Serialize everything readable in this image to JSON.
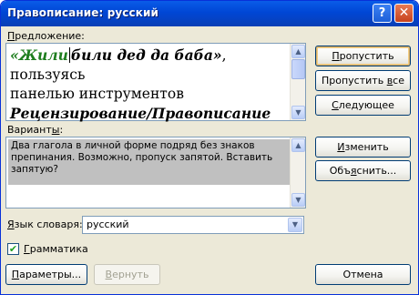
{
  "window": {
    "title": "Правописание: русский",
    "help_label": "?",
    "close_label": "✕"
  },
  "sentence": {
    "label_pre": "",
    "label_u": "П",
    "label_post": "редложение:",
    "flagged_text": "«Жили",
    "text_part2": "били дед да баба»",
    "text_part3": ", пользуясь",
    "line2": "панелью инструментов",
    "line3": "Рецензирование/Правописание"
  },
  "variants": {
    "label_pre": "Вариант",
    "label_u": "ы",
    "label_post": ":",
    "selected_text": "Два глагола в личной форме подряд без знаков препинания. Возможно, пропуск запятой. Вставить запятую?"
  },
  "dictionary": {
    "label_pre": "",
    "label_u": "Я",
    "label_post": "зык словаря:",
    "value": "русский"
  },
  "grammar": {
    "checked": true,
    "check_mark": "✔",
    "label_pre": "",
    "label_u": "Г",
    "label_post": "рамматика"
  },
  "buttons": {
    "skip": {
      "pre": "",
      "u": "П",
      "post": "ропустить"
    },
    "skip_all": {
      "pre": "Пропустить ",
      "u": "в",
      "post": "се"
    },
    "next": {
      "pre": "",
      "u": "С",
      "post": "ледующее"
    },
    "change": {
      "pre": "",
      "u": "И",
      "post": "зменить"
    },
    "explain": {
      "pre": "Объ",
      "u": "я",
      "post": "снить..."
    },
    "options": {
      "pre": "",
      "u": "П",
      "post": "араметры..."
    },
    "undo": {
      "pre": "",
      "u": "В",
      "post": "ернуть"
    },
    "cancel": {
      "label": "Отмена"
    }
  },
  "scroll_icons": {
    "up": "▲",
    "down": "▼"
  }
}
